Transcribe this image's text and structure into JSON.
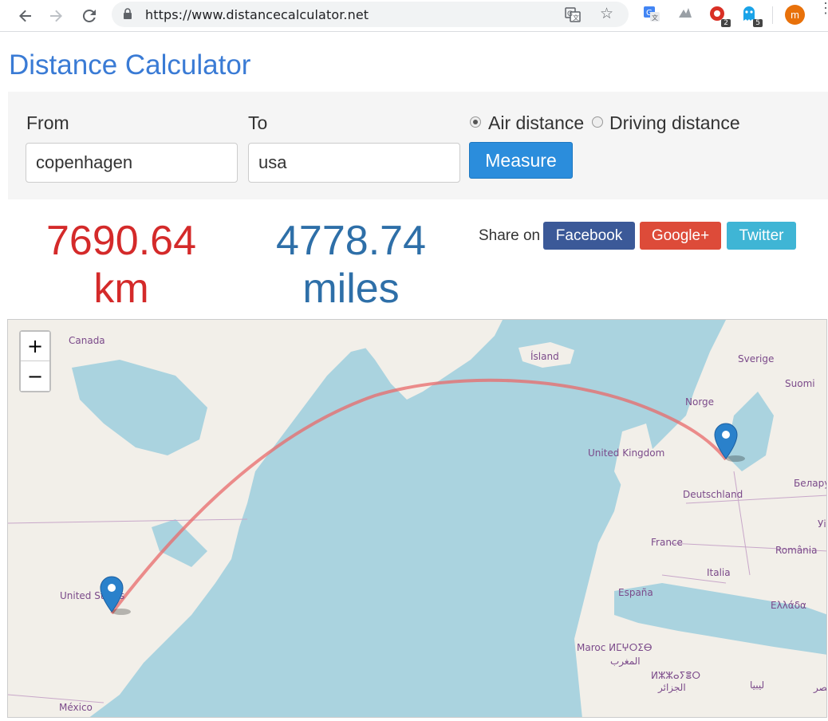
{
  "browser": {
    "url": "https://www.distancecalculator.net",
    "badges": {
      "ext_one": "2",
      "ext_two": "5"
    },
    "avatar_letter": "m"
  },
  "page": {
    "title": "Distance Calculator"
  },
  "form": {
    "from_label": "From",
    "from_value": "copenhagen",
    "to_label": "To",
    "to_value": "usa",
    "air_distance_label": "Air distance",
    "driving_distance_label": "Driving distance",
    "selected_mode": "Air distance",
    "measure_label": "Measure"
  },
  "results": {
    "km_value": "7690.64",
    "km_unit": "km",
    "miles_value": "4778.74",
    "miles_unit": "miles"
  },
  "share": {
    "label": "Share on",
    "facebook": "Facebook",
    "google": "Google+",
    "twitter": "Twitter",
    "colors": {
      "facebook": "#3b5998",
      "google": "#dd4b39",
      "twitter": "#3fb5d5"
    }
  },
  "map": {
    "zoom_in": "+",
    "zoom_out": "−",
    "labels": {
      "canada": "Canada",
      "island": "Ísland",
      "sverige": "Sverige",
      "suomi": "Suomi",
      "norge": "Norge",
      "united_kingdom": "United Kingdom",
      "belarus": "Белару",
      "deutschland": "Deutschland",
      "france": "France",
      "romania": "România",
      "italia": "Italia",
      "espana": "España",
      "ellada": "Ελλάδα",
      "united_states": "United States",
      "maroc": "Maroc ⵍⵎⵖⵔⵉⴱ",
      "maghreb": "المغرب",
      "algerie": "ⵍⵣⵣⴰⵢⴻⵔ",
      "jazair": "الجزائر",
      "libya": "ليبيا",
      "mexico": "México",
      "edge_uk": "Уі",
      "edge_misr": "مصر"
    },
    "route_color": "#f08080",
    "marker_color": "#2a81cb"
  }
}
